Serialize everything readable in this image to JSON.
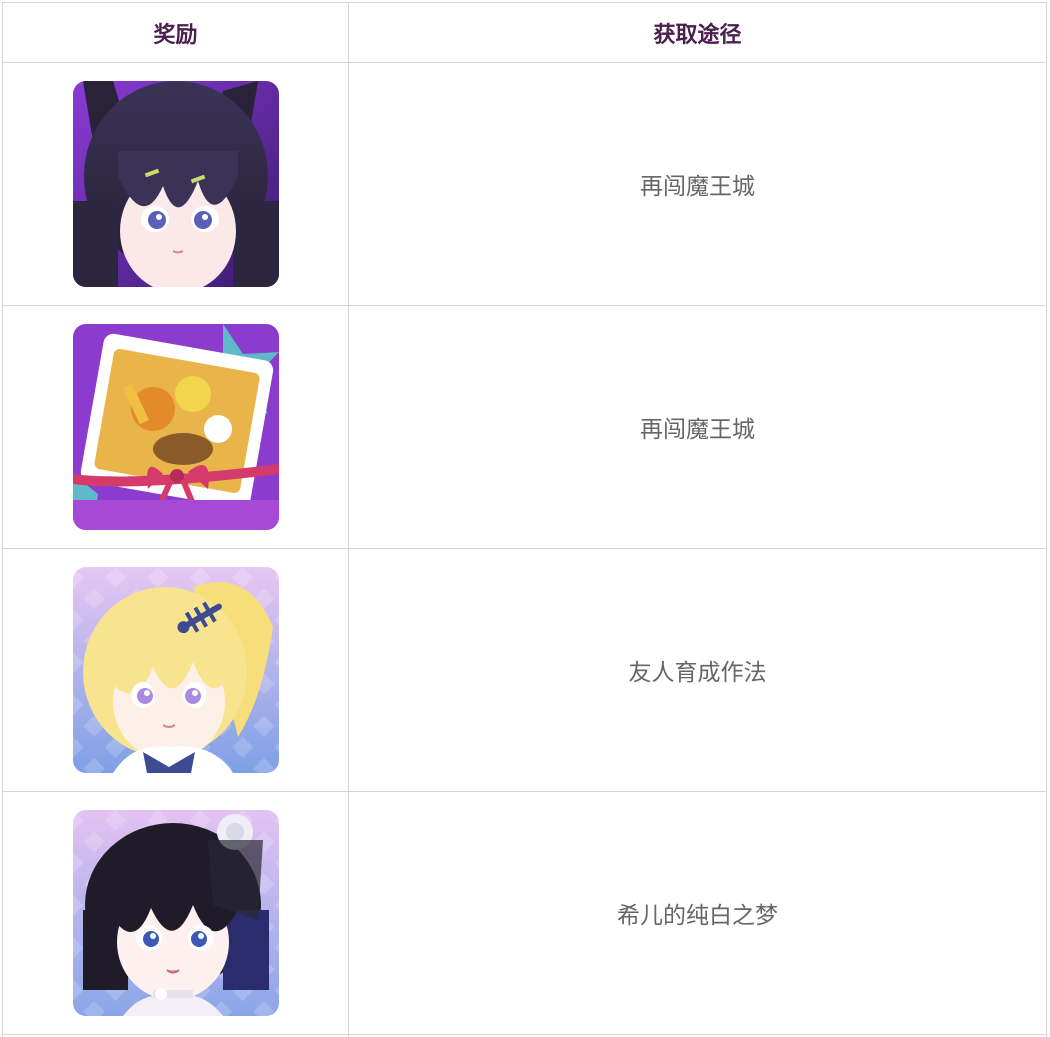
{
  "table": {
    "headers": {
      "reward": "奖励",
      "source": "获取途径"
    },
    "rows": [
      {
        "icon": "dark-haired-cat-ear-girl-portrait",
        "source": "再闯魔王城"
      },
      {
        "icon": "food-platter-stamp-card",
        "source": "再闯魔王城"
      },
      {
        "icon": "blonde-ponytail-girl-portrait",
        "source": "友人育成作法"
      },
      {
        "icon": "black-bob-rose-girl-portrait",
        "source": "希儿的纯白之梦"
      }
    ]
  }
}
